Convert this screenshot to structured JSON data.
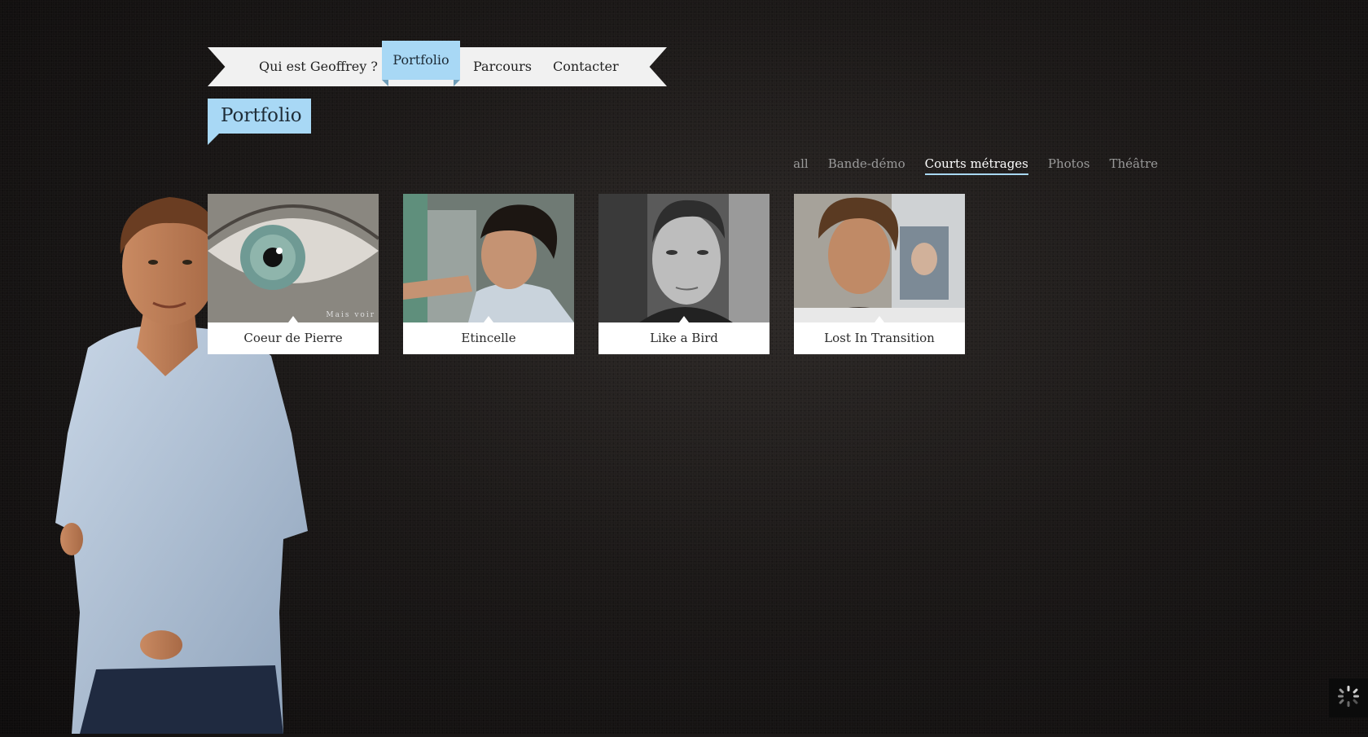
{
  "nav": {
    "items": [
      {
        "label": "Qui est Geoffrey ?"
      },
      {
        "label": "Portfolio"
      },
      {
        "label": "Parcours"
      },
      {
        "label": "Contacter"
      }
    ],
    "active_index": 1
  },
  "page_title": "Portfolio",
  "filters": [
    {
      "label": "all",
      "active": false
    },
    {
      "label": "Bande-démo",
      "active": false
    },
    {
      "label": "Courts métrages",
      "active": true
    },
    {
      "label": "Photos",
      "active": false
    },
    {
      "label": "Théâtre",
      "active": false
    }
  ],
  "cards": [
    {
      "title": "Coeur de Pierre",
      "overlay_text": "Mais voir"
    },
    {
      "title": "Etincelle"
    },
    {
      "title": "Like a Bird"
    },
    {
      "title": "Lost In Transition"
    }
  ],
  "colors": {
    "accent": "#a8d8f5",
    "ribbon": "#f1f1f1",
    "background": "#1c1918"
  },
  "icons": {
    "loader": "loading-spinner-icon"
  }
}
